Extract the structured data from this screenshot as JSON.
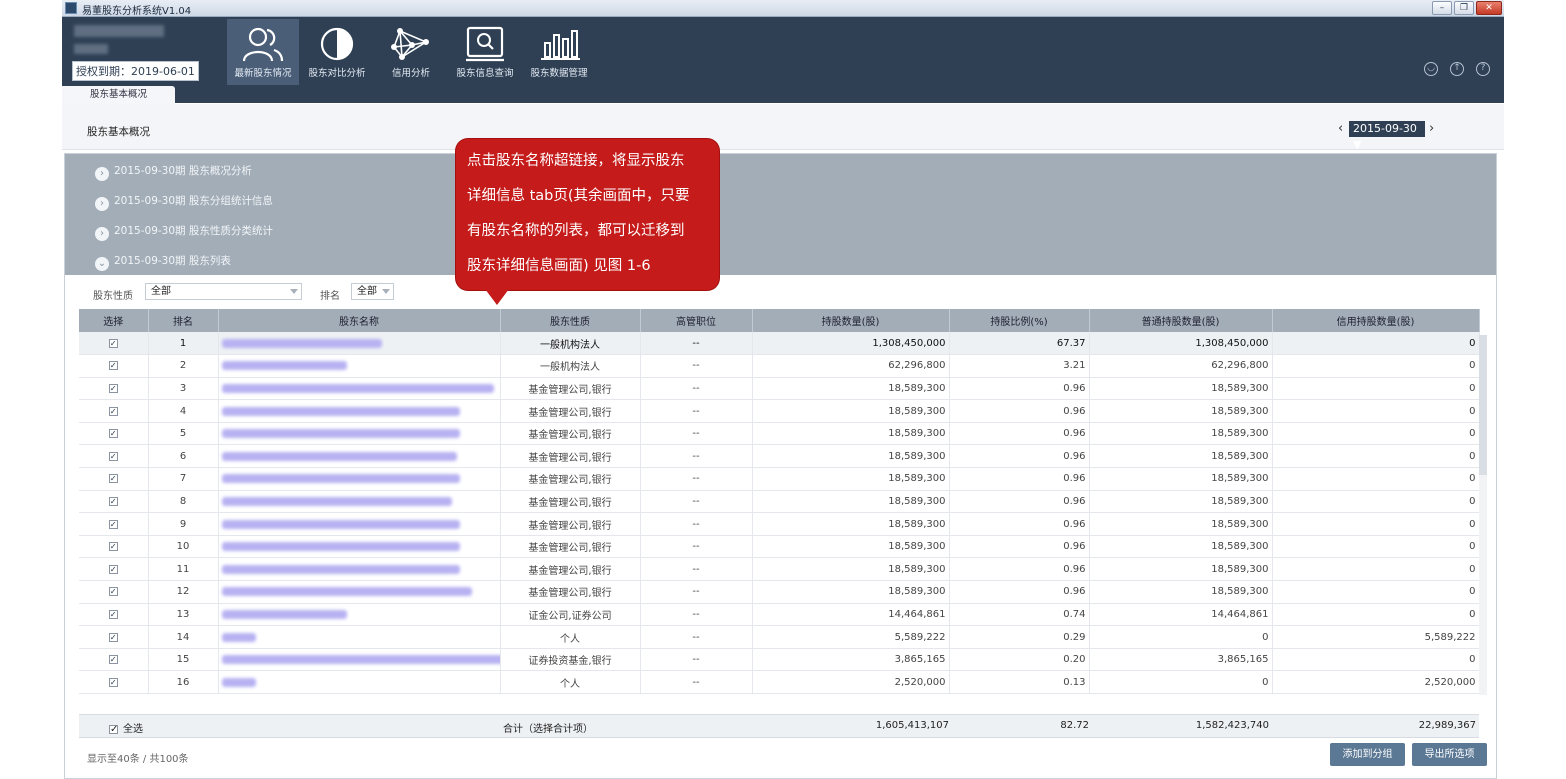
{
  "window": {
    "title": "易董股东分析系统V1.04",
    "minimize": "–",
    "restore": "❐",
    "close": "✕"
  },
  "header": {
    "license": "授权到期：2019-06-01",
    "nav": [
      {
        "label": "最新股东情况",
        "icon": "users-icon"
      },
      {
        "label": "股东对比分析",
        "icon": "half-circle-icon"
      },
      {
        "label": "信用分析",
        "icon": "network-icon"
      },
      {
        "label": "股东信息查询",
        "icon": "search-screen-icon"
      },
      {
        "label": "股东数据管理",
        "icon": "bar-chart-icon"
      }
    ],
    "right_icons": [
      "user-icon",
      "upload-icon",
      "help-icon"
    ],
    "right_glyphs": {
      "user": "◡",
      "upload": "↑",
      "help": "?"
    },
    "tab": "股东基本概况"
  },
  "page": {
    "title": "股东基本概况",
    "date": "2015-09-30",
    "prev": "‹",
    "next": "›",
    "date_arrow": "▼"
  },
  "accordion": [
    {
      "label": "2015-09-30期 股东概况分析",
      "state": "collapsed",
      "glyph": "›"
    },
    {
      "label": "2015-09-30期 股东分组统计信息",
      "state": "collapsed",
      "glyph": "›"
    },
    {
      "label": "2015-09-30期 股东性质分类统计",
      "state": "collapsed",
      "glyph": "›"
    },
    {
      "label": "2015-09-30期 股东列表",
      "state": "expanded",
      "glyph": "⌄"
    }
  ],
  "filters": {
    "nature_label": "股东性质",
    "nature_value": "全部",
    "rank_label": "排名",
    "rank_value": "全部"
  },
  "table": {
    "check_glyph": "✓",
    "columns": [
      "选择",
      "排名",
      "股东名称",
      "股东性质",
      "高管职位",
      "持股数量(股)",
      "持股比例(%)",
      "普通持股数量(股)",
      "信用持股数量(股)"
    ],
    "rows": [
      {
        "rank": "1",
        "nature": "一般机构法人",
        "position": "--",
        "shares": "1,308,450,000",
        "ratio": "67.37",
        "normal": "1,308,450,000",
        "credit": "0"
      },
      {
        "rank": "2",
        "nature": "一般机构法人",
        "position": "--",
        "shares": "62,296,800",
        "ratio": "3.21",
        "normal": "62,296,800",
        "credit": "0"
      },
      {
        "rank": "3",
        "nature": "基金管理公司,银行",
        "position": "--",
        "shares": "18,589,300",
        "ratio": "0.96",
        "normal": "18,589,300",
        "credit": "0"
      },
      {
        "rank": "4",
        "nature": "基金管理公司,银行",
        "position": "--",
        "shares": "18,589,300",
        "ratio": "0.96",
        "normal": "18,589,300",
        "credit": "0"
      },
      {
        "rank": "5",
        "nature": "基金管理公司,银行",
        "position": "--",
        "shares": "18,589,300",
        "ratio": "0.96",
        "normal": "18,589,300",
        "credit": "0"
      },
      {
        "rank": "6",
        "nature": "基金管理公司,银行",
        "position": "--",
        "shares": "18,589,300",
        "ratio": "0.96",
        "normal": "18,589,300",
        "credit": "0"
      },
      {
        "rank": "7",
        "nature": "基金管理公司,银行",
        "position": "--",
        "shares": "18,589,300",
        "ratio": "0.96",
        "normal": "18,589,300",
        "credit": "0"
      },
      {
        "rank": "8",
        "nature": "基金管理公司,银行",
        "position": "--",
        "shares": "18,589,300",
        "ratio": "0.96",
        "normal": "18,589,300",
        "credit": "0"
      },
      {
        "rank": "9",
        "nature": "基金管理公司,银行",
        "position": "--",
        "shares": "18,589,300",
        "ratio": "0.96",
        "normal": "18,589,300",
        "credit": "0"
      },
      {
        "rank": "10",
        "nature": "基金管理公司,银行",
        "position": "--",
        "shares": "18,589,300",
        "ratio": "0.96",
        "normal": "18,589,300",
        "credit": "0"
      },
      {
        "rank": "11",
        "nature": "基金管理公司,银行",
        "position": "--",
        "shares": "18,589,300",
        "ratio": "0.96",
        "normal": "18,589,300",
        "credit": "0"
      },
      {
        "rank": "12",
        "nature": "基金管理公司,银行",
        "position": "--",
        "shares": "18,589,300",
        "ratio": "0.96",
        "normal": "18,589,300",
        "credit": "0"
      },
      {
        "rank": "13",
        "nature": "证金公司,证券公司",
        "position": "--",
        "shares": "14,464,861",
        "ratio": "0.74",
        "normal": "14,464,861",
        "credit": "0"
      },
      {
        "rank": "14",
        "nature": "个人",
        "position": "--",
        "shares": "5,589,222",
        "ratio": "0.29",
        "normal": "0",
        "credit": "5,589,222"
      },
      {
        "rank": "15",
        "nature": "证券投资基金,银行",
        "position": "--",
        "shares": "3,865,165",
        "ratio": "0.20",
        "normal": "3,865,165",
        "credit": "0"
      },
      {
        "rank": "16",
        "nature": "个人",
        "position": "--",
        "shares": "2,520,000",
        "ratio": "0.13",
        "normal": "0",
        "credit": "2,520,000"
      }
    ]
  },
  "totals": {
    "select_all": "全选",
    "label": "合计（选择合计项）",
    "shares": "1,605,413,107",
    "ratio": "82.72",
    "normal": "1,582,423,740",
    "credit": "22,989,367"
  },
  "footer": {
    "count": "显示至40条 / 共100条",
    "add_group": "添加到分组",
    "export": "导出所选项"
  },
  "callout": {
    "lines": [
      "点击股东名称超链接，将显示股东",
      "详细信息 tab页(其余画面中，只要",
      "有股东名称的列表，都可以迁移到",
      "股东详细信息画面) 见图 1-6"
    ]
  },
  "colors": {
    "header_bg": "#2f4055",
    "accordion_bg": "#a2adb7",
    "callout_bg": "#c51b1b",
    "button_bg": "#5b7894"
  }
}
